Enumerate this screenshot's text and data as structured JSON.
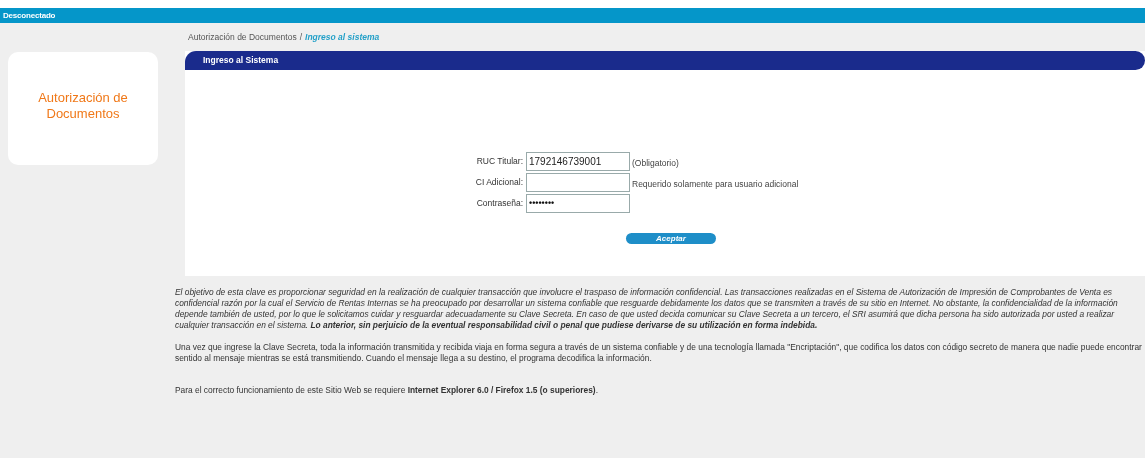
{
  "top_bar": {
    "status": "Desconectado"
  },
  "sidebar": {
    "title": "Autorización de Documentos"
  },
  "breadcrumb_separator": "/",
  "breadcrumb": [
    {
      "label": "Autorización de Documentos",
      "selected": false
    },
    {
      "label": "Ingreso al sistema",
      "selected": true
    }
  ],
  "panel": {
    "title": "Ingreso al Sistema"
  },
  "form": {
    "fields": [
      {
        "label": "RUC Titular:",
        "kind": "text",
        "value": "1792146739001",
        "note": "(Obligatorio)"
      },
      {
        "label": "CI Adicional:",
        "kind": "text",
        "note": "Requerido solamente para usuario adicional"
      },
      {
        "label": "Contraseña:",
        "kind": "password",
        "value": "••••••••"
      }
    ],
    "submit": "Aceptar"
  },
  "paragraphs": [
    "El objetivo de esta clave es proporcionar seguridad en la realización de cualquier transacción que involucre el traspaso de información confidencial. Las transacciones realizadas en el Sistema de Autorización de Impresión de Comprobantes de Venta es confidencial razón por la cual el Servicio de Rentas Internas se ha preocupado por desarrollar un sistema confiable que resguarde debidamente los datos que se transmiten a través de su sitio en Internet. No obstante, la confidencialidad de la información depende también de usted, por lo que le solicitamos cuidar y resguardar adecuadamente su Clave Secreta. En caso de que usted decida comunicar su Clave Secreta a un tercero, el SRI asumirá que dicha persona ha sido autorizada por usted a realizar cualquier transacción en el sistema. **Lo anterior, sin perjuicio de la eventual responsabilidad civil o penal que pudiese derivarse de su utilización en forma indebida.**",
    "Una vez que ingrese la Clave Secreta, toda la información transmitida y recibida viaja en forma segura a través de un sistema confiable y de una tecnología llamada \"Encriptación\", que codifica los datos con código secreto de manera que nadie puede encontrar sentido al mensaje mientras se está transmitiendo. Cuando el mensaje llega a su destino, el programa decodifica la información.",
    "Para el correcto funcionamiento de este Sitio Web se requiere **Internet Explorer 6.0 / Firefox 1.5 (o superiores)**."
  ]
}
